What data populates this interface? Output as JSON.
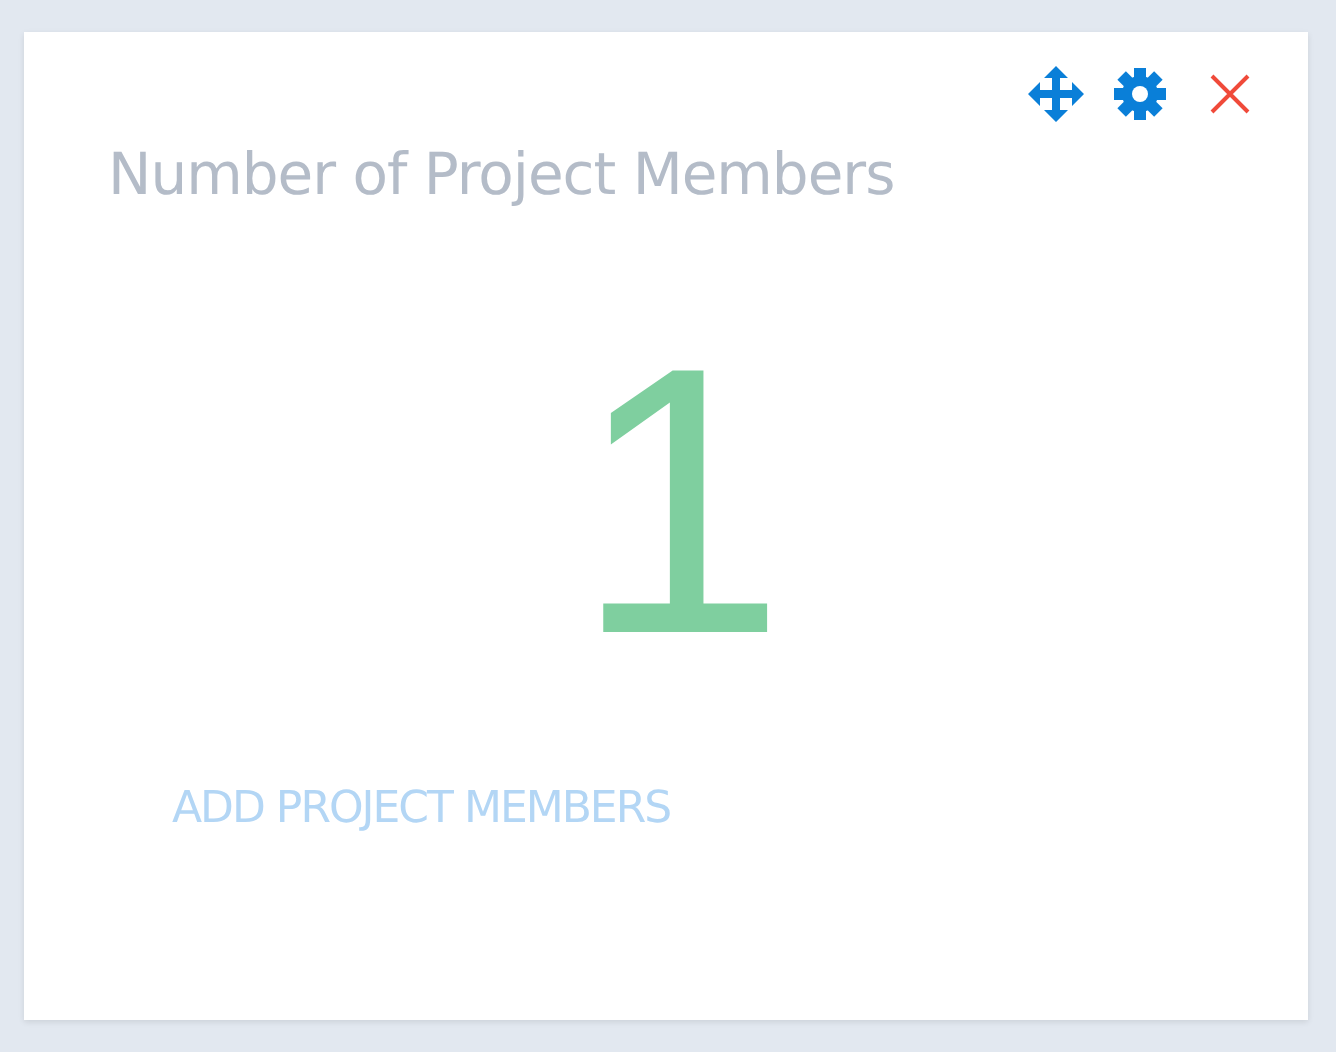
{
  "widget": {
    "title": "Number of Project Members",
    "value": "1",
    "action": "ADD PROJECT MEMBERS"
  }
}
